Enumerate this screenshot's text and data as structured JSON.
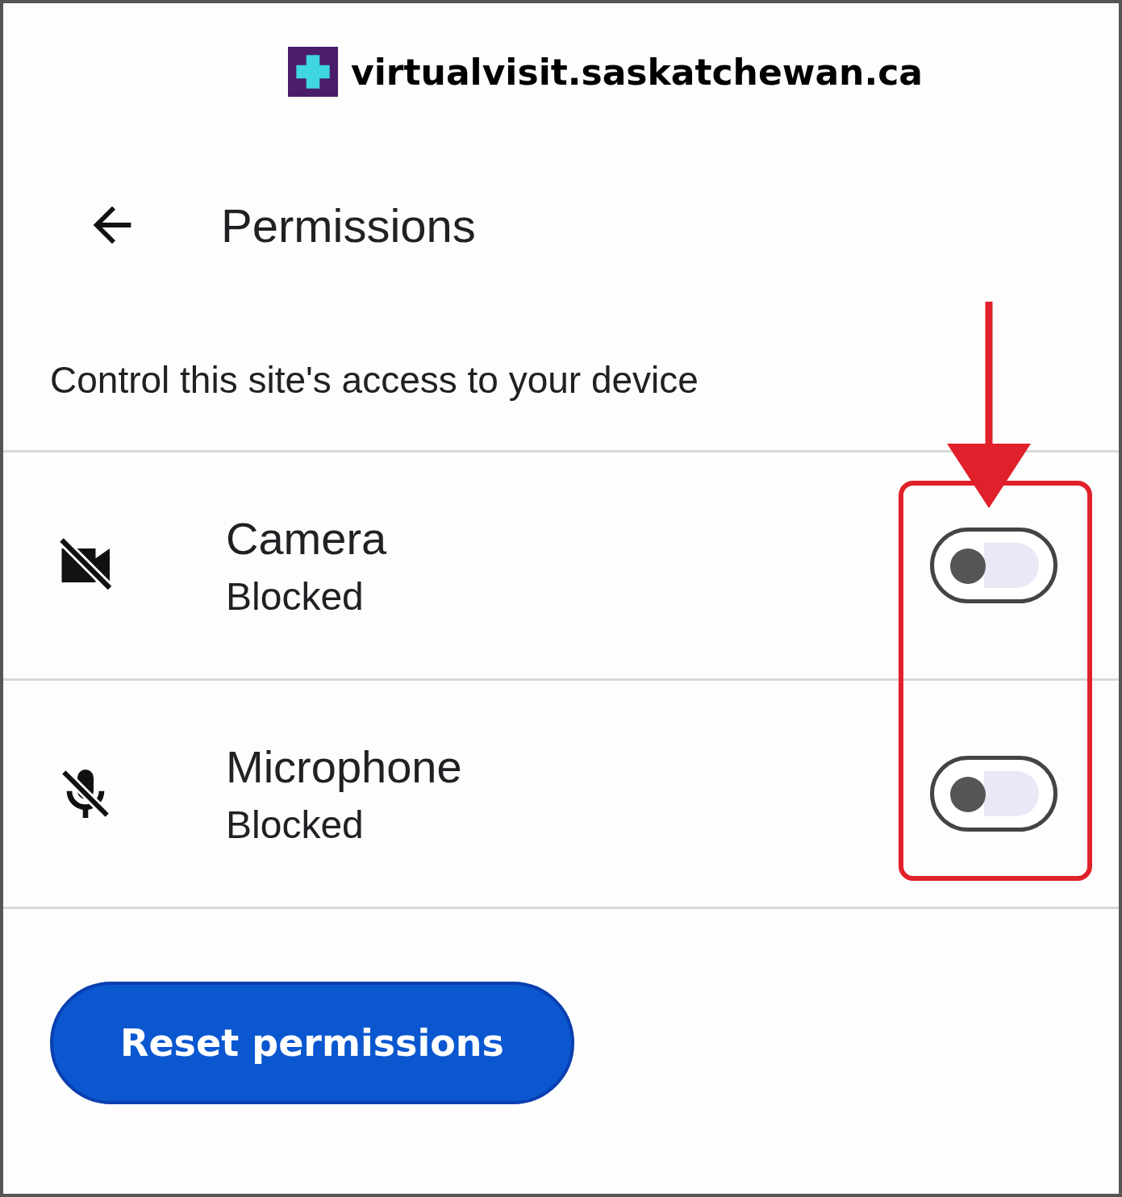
{
  "site": {
    "domain": "virtualvisit.saskatchewan.ca"
  },
  "header": {
    "title": "Permissions"
  },
  "description": "Control this site's access to your device",
  "permissions": [
    {
      "kind": "camera",
      "name": "Camera",
      "status": "Blocked",
      "on": false
    },
    {
      "kind": "microphone",
      "name": "Microphone",
      "status": "Blocked",
      "on": false
    }
  ],
  "reset_button": "Reset permissions"
}
